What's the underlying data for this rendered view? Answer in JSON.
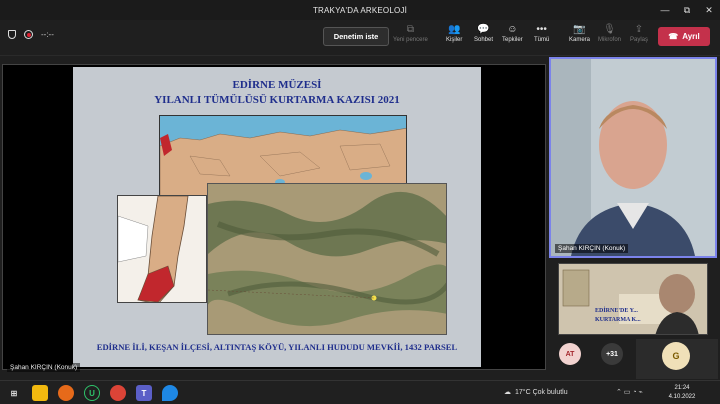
{
  "window": {
    "title": "TRAKYA'DA ARKEOLOJİ",
    "minimize": "—",
    "maximize": "⧉",
    "close": "✕"
  },
  "toolbar": {
    "timer": "--:--",
    "control_label": "Denetim iste",
    "items": [
      {
        "label": "Yeni pencere",
        "icon": "new-window-icon",
        "enabled": false
      },
      {
        "label": "Kişiler",
        "icon": "people-icon",
        "enabled": true
      },
      {
        "label": "Sohbet",
        "icon": "chat-icon",
        "enabled": true
      },
      {
        "label": "Tepkiler",
        "icon": "reactions-icon",
        "enabled": true
      },
      {
        "label": "Tümü",
        "icon": "more-icon",
        "enabled": true
      },
      {
        "label": "Kamera",
        "icon": "camera-off-icon",
        "enabled": true
      },
      {
        "label": "Mikrofon",
        "icon": "mic-off-icon",
        "enabled": false
      },
      {
        "label": "Paylaş",
        "icon": "share-icon",
        "enabled": false
      }
    ],
    "leave_label": "Ayrıl",
    "leave_color": "#c4314b"
  },
  "slide": {
    "title_line1": "EDİRNE MÜZESİ",
    "title_line2": "YILANLI TÜMÜLÜSÜ KURTARMA KAZISI 2021",
    "caption": "EDİRNE İLİ, KEŞAN İLÇESİ, ALTINTAŞ KÖYÜ, YILANLI HUDUDU MEVKİİ, 1432 PARSEL",
    "text_color": "#1f2e8c"
  },
  "presenter_label": "Şahan KIRÇIN (Konuk)",
  "participants": {
    "main_video_name": "Şahan KIRÇIN (Konuk)",
    "small_video_caption": "EDİRNE'DE Y...",
    "small_video_caption2": "KURTARMA K...",
    "avatar_at": "AT",
    "more_count": "+31",
    "avatar_g": "G"
  },
  "taskbar": {
    "weather": "17°C  Çok bulutlu",
    "time": "21:24",
    "date": "4.10.2022"
  }
}
